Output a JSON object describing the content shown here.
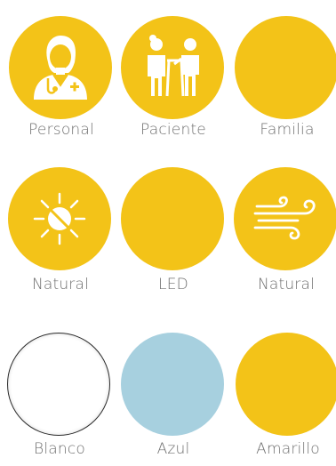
{
  "colors": {
    "yellow": "#f3c318",
    "blue": "#a7d0df",
    "white": "#ffffff",
    "icon": "#ffffff",
    "label_text": "#6e6e6e"
  },
  "rows": [
    {
      "items": [
        {
          "label": "Personal",
          "icon": "doctor-icon"
        },
        {
          "label": "Paciente",
          "icon": "patient-with-walker-icon"
        },
        {
          "label": "Familia",
          "icon": "none"
        }
      ]
    },
    {
      "items": [
        {
          "label": "Natural",
          "icon": "sun-icon"
        },
        {
          "label": "LED",
          "icon": "none"
        },
        {
          "label": "Natural",
          "icon": "wind-icon"
        }
      ]
    },
    {
      "items": [
        {
          "label": "Blanco",
          "icon": "none"
        },
        {
          "label": "Azul",
          "icon": "none"
        },
        {
          "label": "Amarillo",
          "icon": "none"
        }
      ]
    }
  ]
}
